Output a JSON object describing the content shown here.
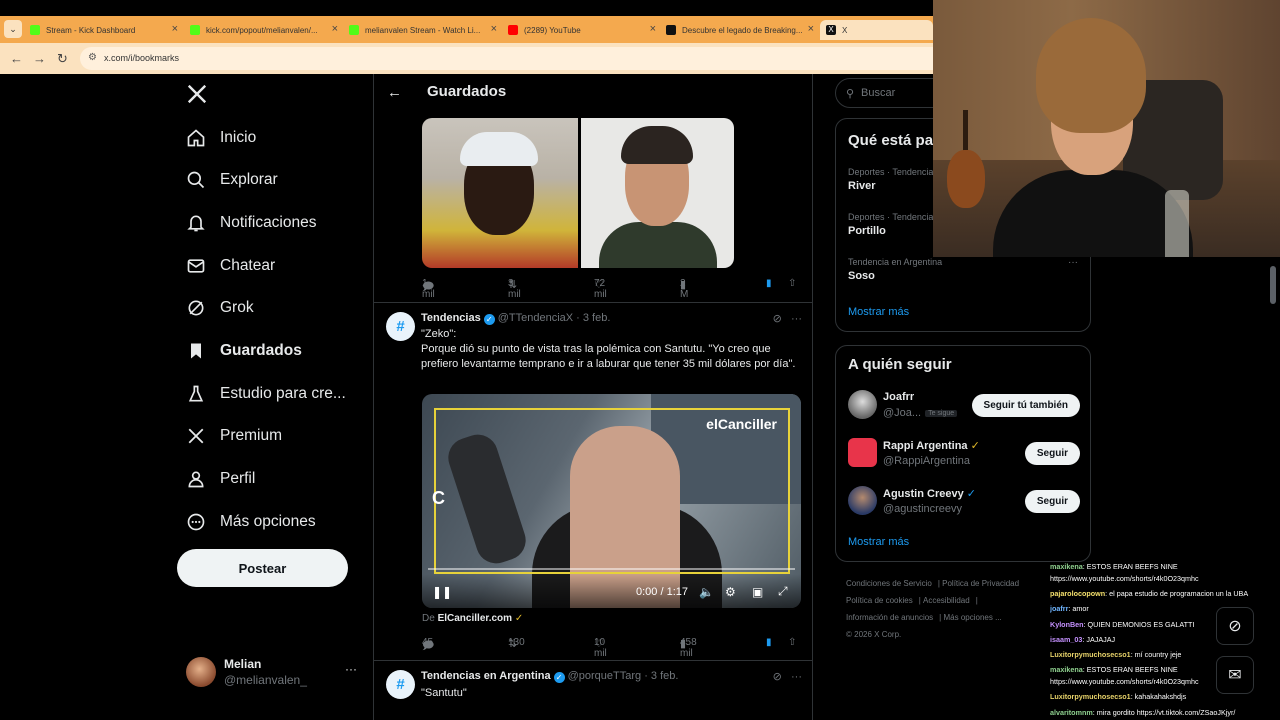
{
  "browser": {
    "tabs": [
      {
        "label": "Stream - Kick Dashboard",
        "favicon": "kick-icon"
      },
      {
        "label": "kick.com/popout/melianvalen/...",
        "favicon": "kick-icon"
      },
      {
        "label": "melianvalen Stream - Watch Li...",
        "favicon": "kick-icon"
      },
      {
        "label": "(2289) YouTube",
        "favicon": "youtube-icon"
      },
      {
        "label": "Descubre el legado de Breaking...",
        "favicon": "tiktok-icon"
      },
      {
        "label": "X",
        "favicon": "x-icon"
      }
    ],
    "url": "x.com/i/bookmarks"
  },
  "nav": {
    "items": [
      {
        "label": "Inicio",
        "icon": "home-icon"
      },
      {
        "label": "Explorar",
        "icon": "search-icon"
      },
      {
        "label": "Notificaciones",
        "icon": "bell-icon"
      },
      {
        "label": "Chatear",
        "icon": "mail-icon"
      },
      {
        "label": "Grok",
        "icon": "grok-icon"
      },
      {
        "label": "Guardados",
        "icon": "bookmark-icon"
      },
      {
        "label": "Estudio para cre...",
        "icon": "creator-studio-icon"
      },
      {
        "label": "Premium",
        "icon": "x-icon"
      },
      {
        "label": "Perfil",
        "icon": "person-icon"
      },
      {
        "label": "Más opciones",
        "icon": "more-circle-icon"
      }
    ],
    "post_label": "Postear",
    "account": {
      "name": "Melian",
      "handle": "@melianvalen_"
    }
  },
  "header": {
    "title": "Guardados"
  },
  "tweet_prev": {
    "replies": "1 mil",
    "reposts": "3 mil",
    "likes": "72 mil",
    "views": "2 M"
  },
  "tweet1": {
    "name": "Tendencias",
    "handle": "@TTendenciaX",
    "date": "3 feb.",
    "text_line1": "\"Zeko\":",
    "text_rest": "Porque dió su punto de vista tras la polémica con Santutu. \"Yo creo que prefiero levantarme temprano e ir a laburar que tener 35 mil dólares por día\".",
    "video": {
      "overlay_text": "elCanciller",
      "time": "0:00 / 1:17",
      "letter": "C"
    },
    "source_prefix": "De",
    "source": "ElCanciller.com",
    "replies": "45",
    "reposts": "130",
    "likes": "10 mil",
    "views": "458 mil"
  },
  "tweet2": {
    "name": "Tendencias en Argentina",
    "handle": "@porqueTTarg",
    "date": "3 feb.",
    "text": "\"Santutu\""
  },
  "search": {
    "placeholder": "Buscar"
  },
  "trends": {
    "title": "Qué está pa",
    "items": [
      {
        "context": "Deportes · Tendencia",
        "name": "River"
      },
      {
        "context": "Deportes · Tendencia",
        "name": "Portillo"
      },
      {
        "context": "Tendencia en Argentina",
        "name": "Soso"
      }
    ],
    "show_more": "Mostrar más"
  },
  "who_to_follow": {
    "title": "A quién seguir",
    "items": [
      {
        "name": "Joafrr",
        "handle": "@Joa...",
        "badge": "Te sigue",
        "button": "Seguir tú también"
      },
      {
        "name": "Rappi Argentina",
        "handle": "@RappiArgentina",
        "badge": "",
        "button": "Seguir"
      },
      {
        "name": "Agustin Creevy",
        "handle": "@agustincreevy",
        "badge": "",
        "button": "Seguir"
      }
    ],
    "show_more": "Mostrar más"
  },
  "footer": {
    "links": [
      "Condiciones de Servicio",
      "Política de Privacidad",
      "Política de cookies",
      "Accesibilidad",
      "Información de anuncios",
      "Más opciones ..."
    ],
    "copyright": "© 2026 X Corp."
  },
  "chat": [
    {
      "user": "maxikena",
      "text": ": ESTOS ERAN BEEFS NINE",
      "color": "#8fd18f"
    },
    {
      "user": "",
      "text": "https://www.youtube.com/shorts/r4k0O23qmhc",
      "color": "#ffffff"
    },
    {
      "user": "pajarolocopown",
      "text": ": el papa estudio de programacion un la UBA",
      "color": "#f4e06d"
    },
    {
      "user": "joafrr",
      "text": ": amor",
      "color": "#6fb5ff"
    },
    {
      "user": "KylonBen",
      "text": ": QUIEN DEMONIOS ES GALATTI",
      "color": "#c591ff"
    },
    {
      "user": "isaam_03",
      "text": ": JAJAJAJ",
      "color": "#c591ff"
    },
    {
      "user": "Luxitorpymuchosecso1",
      "text": ": mí country jeje",
      "color": "#e8d36a"
    },
    {
      "user": "maxikena",
      "text": ": ESTOS ERAN BEEFS NINE",
      "color": "#8fd18f"
    },
    {
      "user": "",
      "text": "https://www.youtube.com/shorts/r4k0O23qmhc",
      "color": "#ffffff"
    },
    {
      "user": "Luxitorpymuchosecso1",
      "text": ": kahakahakshdjs",
      "color": "#e8d36a"
    },
    {
      "user": "alvaritomnm",
      "text": ": mira gordito https://vt.tiktok.com/ZSaoJKjyr/",
      "color": "#8fd18f"
    }
  ],
  "colors": {
    "accent": "#1d9bf0",
    "tabbar": "#f4a94e",
    "background": "#000000"
  }
}
